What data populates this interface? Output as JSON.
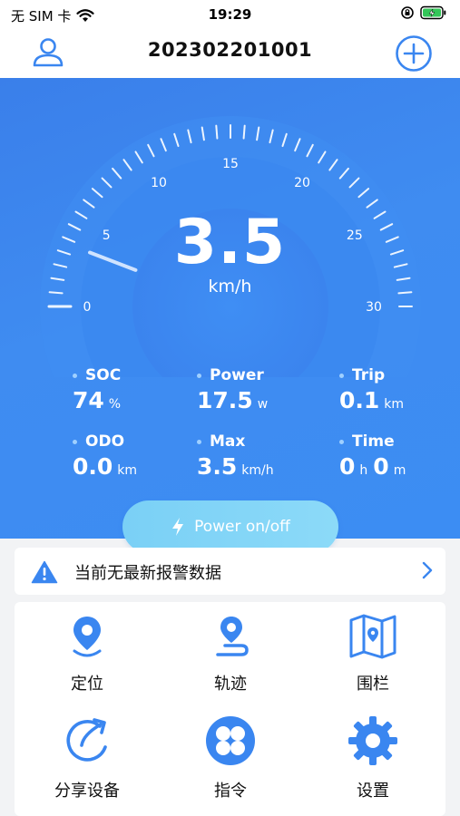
{
  "status_bar": {
    "carrier": "无 SIM 卡",
    "time": "19:29"
  },
  "header": {
    "title": "202302201001",
    "user_icon": "user-icon",
    "add_icon": "plus-circle-icon"
  },
  "speed": {
    "value": "3.5",
    "unit": "km/h",
    "ticks": [
      "0",
      "5",
      "10",
      "15",
      "20",
      "25",
      "30"
    ],
    "min": 0,
    "max": 30
  },
  "stats": {
    "soc": {
      "label": "SOC",
      "value": "74",
      "unit": "%"
    },
    "power": {
      "label": "Power",
      "value": "17.5",
      "unit": "w"
    },
    "trip": {
      "label": "Trip",
      "value": "0.1",
      "unit": "km"
    },
    "odo": {
      "label": "ODO",
      "value": "0.0",
      "unit": "km"
    },
    "max": {
      "label": "Max",
      "value": "3.5",
      "unit": "km/h"
    },
    "time": {
      "label": "Time",
      "h_value": "0",
      "h_unit": "h",
      "m_value": "0",
      "m_unit": "m"
    }
  },
  "power_button": {
    "label": "Power on/off",
    "icon": "lightning-icon"
  },
  "alarm": {
    "text": "当前无最新报警数据",
    "icon": "warning-icon"
  },
  "functions": [
    {
      "label": "定位",
      "icon": "location-pin-icon"
    },
    {
      "label": "轨迹",
      "icon": "track-icon"
    },
    {
      "label": "围栏",
      "icon": "map-fence-icon"
    },
    {
      "label": "分享设备",
      "icon": "share-icon"
    },
    {
      "label": "指令",
      "icon": "command-icon"
    },
    {
      "label": "设置",
      "icon": "settings-gear-icon"
    }
  ],
  "colors": {
    "primary": "#3a86f0",
    "power_button": "#84d6f7",
    "text": "#111111"
  }
}
